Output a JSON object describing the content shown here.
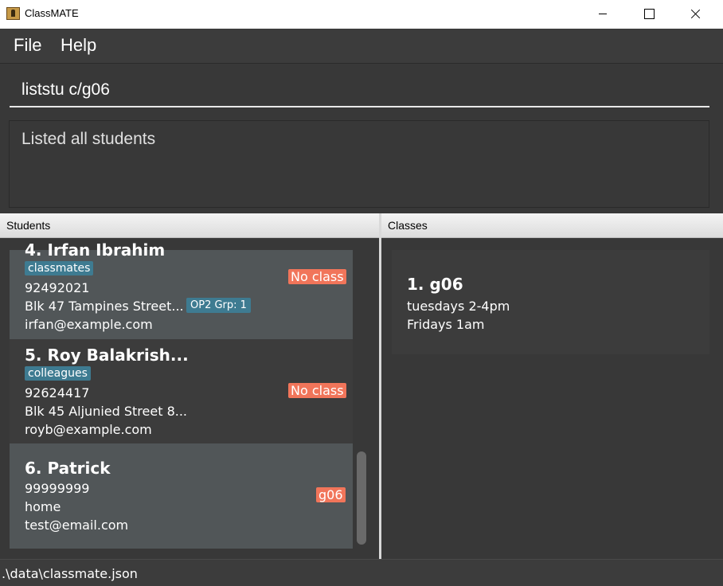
{
  "window": {
    "title": "ClassMATE"
  },
  "menu": {
    "file": "File",
    "help": "Help"
  },
  "command": {
    "value": "liststu c/g06"
  },
  "result": {
    "text": "Listed all students"
  },
  "panels": {
    "students_header": "Students",
    "classes_header": "Classes"
  },
  "students": [
    {
      "name": "4.  Irfan Ibrahim",
      "tag": "classmates",
      "phone": "92492021",
      "address": "Blk 47 Tampines Street...",
      "email": "irfan@example.com",
      "class_badge": "No class",
      "group_badge": "OP2 Grp: 1"
    },
    {
      "name": "5.  Roy Balakrish...",
      "tag": "colleagues",
      "phone": "92624417",
      "address": "Blk 45 Aljunied Street 8...",
      "email": "royb@example.com",
      "class_badge": "No class"
    },
    {
      "name": "6.  Patrick",
      "phone": "99999999",
      "address": "home",
      "email": "test@email.com",
      "class_badge": "g06"
    }
  ],
  "classes": [
    {
      "name": "1.  g06",
      "schedule": [
        "tuesdays 2-4pm",
        "Fridays 1am"
      ]
    }
  ],
  "status": {
    "path": ".\\data\\classmate.json"
  },
  "colors": {
    "tag_blue": "#3e7b91",
    "badge_orange": "#f1755a",
    "selected_card": "#515658"
  }
}
